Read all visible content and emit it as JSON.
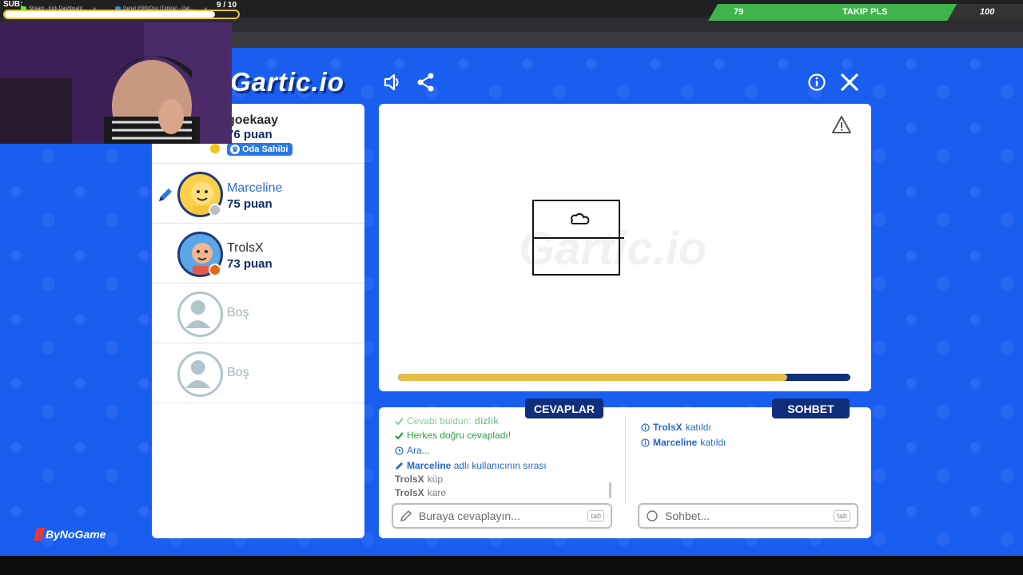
{
  "overlay": {
    "sub_label": "SUB:",
    "sub_progress": 0.9,
    "sub_count": "9  / 10",
    "follow_current": "79",
    "follow_title": "TAKIP PLS",
    "follow_goal": "100",
    "follow_progress": 0.79
  },
  "browser": {
    "tab1_title": "Stream - Kick Dashboard",
    "tab2_title": "Genel #SMzOsu (Türkçe) - Gar..."
  },
  "game": {
    "logo": "Gartic.io",
    "watermark": "Gartic.io",
    "timer_remaining": 0.86
  },
  "players": [
    {
      "name": "goekaay",
      "score": "76 puan",
      "badge": "Oda Sahibi",
      "status_color": "#f0c419"
    },
    {
      "name": "Marceline",
      "score": "75 puan",
      "drawing": true,
      "status_color": "#bdbdbd"
    },
    {
      "name": "TrolsX",
      "score": "73 puan",
      "status_color": "#e06b12"
    },
    {
      "name": "Boş",
      "empty": true
    },
    {
      "name": "Boş",
      "empty": true
    }
  ],
  "answers": {
    "label": "CEVAPLAR",
    "messages": [
      {
        "text": "Cevabı buldun: ",
        "strong": "dizlik",
        "type": "check"
      },
      {
        "text": "Herkes doğru cevapladı!",
        "type": "check"
      },
      {
        "text": "Ara...",
        "type": "clock"
      },
      {
        "user": "Marceline",
        "text": " adlı kullanıcının sırası",
        "type": "pencil"
      },
      {
        "user": "TrolsX",
        "text": " küp",
        "type": "guess"
      },
      {
        "user": "TrolsX",
        "text": " kare",
        "type": "guess"
      }
    ],
    "placeholder": "Buraya cevaplayın...",
    "tab_hint": "tab"
  },
  "chat": {
    "label": "SOHBET",
    "messages": [
      {
        "user": "TrolsX",
        "text": " katıldı"
      },
      {
        "user": "Marceline",
        "text": " katıldı"
      }
    ],
    "placeholder": "Sohbet...",
    "tab_hint": "tab"
  },
  "sponsor": "ByNoGame",
  "icons": [
    "sound-icon",
    "share-icon",
    "info-icon",
    "close-icon",
    "warning-icon",
    "pencil-icon",
    "search-icon"
  ]
}
